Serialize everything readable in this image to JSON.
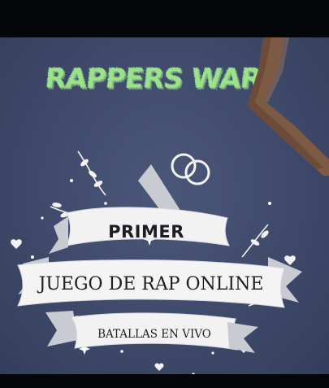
{
  "game": {
    "title": "RAPPERS WAR"
  },
  "banner": {
    "line1": "PRIMER",
    "line2": "JUEGO DE RAP ONLINE",
    "line3": "BATALLAS EN VIVO"
  },
  "colors": {
    "background": "#3f4a6b",
    "title_green": "#9be38a",
    "ribbon_light": "#f2f2f2",
    "ribbon_shadow": "#c9cbd3",
    "branch_brown": "#7c5a43",
    "sparkle": "#ffffff"
  },
  "icons": [
    "wedding-rings-icon",
    "heart-icon",
    "sparkle-icon",
    "leaf-sprig-icon"
  ]
}
